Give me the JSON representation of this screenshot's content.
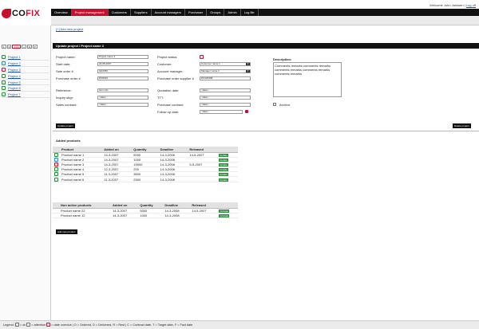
{
  "header": {
    "logo_text": "CO",
    "logo_text_x": "FIX",
    "welcome": "Welcome John Janssen |",
    "logout": "Log off"
  },
  "nav": [
    "Overview",
    "Project management",
    "Customers",
    "Suppliers",
    "Account managers",
    "Purchaser",
    "Groups",
    "Admin",
    "Log file"
  ],
  "sidebar": {
    "filters": [
      "1",
      "2",
      "3-0%",
      "x",
      "S",
      "F"
    ],
    "projects": [
      {
        "label": "Project 1",
        "badge": "✓",
        "color": "g"
      },
      {
        "label": "Project 2",
        "badge": "!",
        "color": "b"
      },
      {
        "label": "Project 3",
        "badge": "!",
        "color": "r"
      },
      {
        "label": "Project 4",
        "badge": "✓",
        "color": "g"
      },
      {
        "label": "Project 5",
        "badge": "✓",
        "color": "g"
      },
      {
        "label": "Project 6",
        "badge": "✓",
        "color": "g"
      },
      {
        "label": "Project 7",
        "badge": "✓",
        "color": "g"
      }
    ]
  },
  "main": {
    "add_project": "[+] Add new project",
    "section_title": "Update project / Project name 3",
    "fields": {
      "project_name_label": "Project name:",
      "project_name": "Project name 3",
      "start_date_label": "Start date:",
      "start_date": "22-05-2007",
      "sale_order_label": "Sale order #",
      "sale_order": "SO2356",
      "purchase_order_label": "Purchase order #",
      "purchase_order": "PO0015",
      "reference_label": "Reference:",
      "reference": "item refs",
      "inquiry_label": "Inquiry sbgr:",
      "inquiry": "<date>",
      "sales_contract_label": "Sales contract:",
      "sales_contract": "<date>",
      "project_status_label": "Project status:",
      "project_status_badge": "!",
      "customer_label": "Customer:",
      "customer": "Customer name 1",
      "account_manager_label": "Account manager:",
      "account_manager": "Manager name 2",
      "purchase_order_supplier_label": "Purchase order supplier #",
      "purchase_order_supplier": "PO425398",
      "quotation_label": "Quotation date:",
      "quotation": "<date>",
      "ttt_label": "TTT:",
      "ttt": "<date>",
      "purchase_contract_label": "Purchase contract:",
      "purchase_contract": "<date>",
      "follow_up_label": "Follow up date:",
      "follow_up": "<date>",
      "description_label": "Description:",
      "description": "Comments remarks comments remarks comments remarks comments remarks comments remarks",
      "archive_label": "Archive"
    },
    "update_project_button": "Update project",
    "delete_project_button": "Delete project",
    "added_products_title": "Added products",
    "added_products": {
      "headers": [
        "Product",
        "Added on",
        "Quantity",
        "Deadline",
        "Released"
      ],
      "rows": [
        {
          "badge": "✓",
          "color": "g",
          "product": "Product name 1",
          "added": "14-3-2007",
          "qty": "5000",
          "deadline": "14-3-2008",
          "released": "14-5-2007"
        },
        {
          "badge": "!",
          "color": "b",
          "product": "Product name 2",
          "added": "14-3-2007",
          "qty": "1000",
          "deadline": "14-3-2008",
          "released": ""
        },
        {
          "badge": "!",
          "color": "r",
          "product": "Product name 3",
          "added": "14-3-2007",
          "qty": "15000",
          "deadline": "14-3-2008",
          "released": "5-5-2007"
        },
        {
          "badge": "✓",
          "color": "g",
          "product": "Product name 4",
          "added": "12-3-2007",
          "qty": "200",
          "deadline": "14-3-2008",
          "released": ""
        },
        {
          "badge": "✓",
          "color": "g",
          "product": "Product name 5",
          "added": "11-3-2007",
          "qty": "3600",
          "deadline": "14-3-2008",
          "released": ""
        },
        {
          "badge": "✓",
          "color": "g",
          "product": "Product name 6",
          "added": "11-3-2007",
          "qty": "2500",
          "deadline": "14-3-2008",
          "released": ""
        }
      ],
      "action": "Update"
    },
    "inactive_products": {
      "headers": [
        "Non active products",
        "Added on",
        "Quantity",
        "Deadline",
        "Released"
      ],
      "rows": [
        {
          "product": "Product name 22",
          "added": "14-3-2007",
          "qty": "5000",
          "deadline": "14-3-2008",
          "released": "14-5-2007"
        },
        {
          "product": "Product name 12",
          "added": "14-3-2007",
          "qty": "1000",
          "deadline": "14-3-2008",
          "released": ""
        }
      ],
      "action": "Activate"
    },
    "add_product_button": "Add new product"
  },
  "footer": {
    "legend_prefix": "Legend:",
    "legend_ok": "= ok",
    "legend_attention": "= attention",
    "legend_rest": "= date overdue | O = Ordered, D = Delivered, R = Rest | C = Contract date, T = Target date, F = Fact date"
  },
  "colors": {
    "accent": "#c8102e",
    "nav": "#111111",
    "ok": "#2e8b3d",
    "attention": "#1e88c8"
  }
}
